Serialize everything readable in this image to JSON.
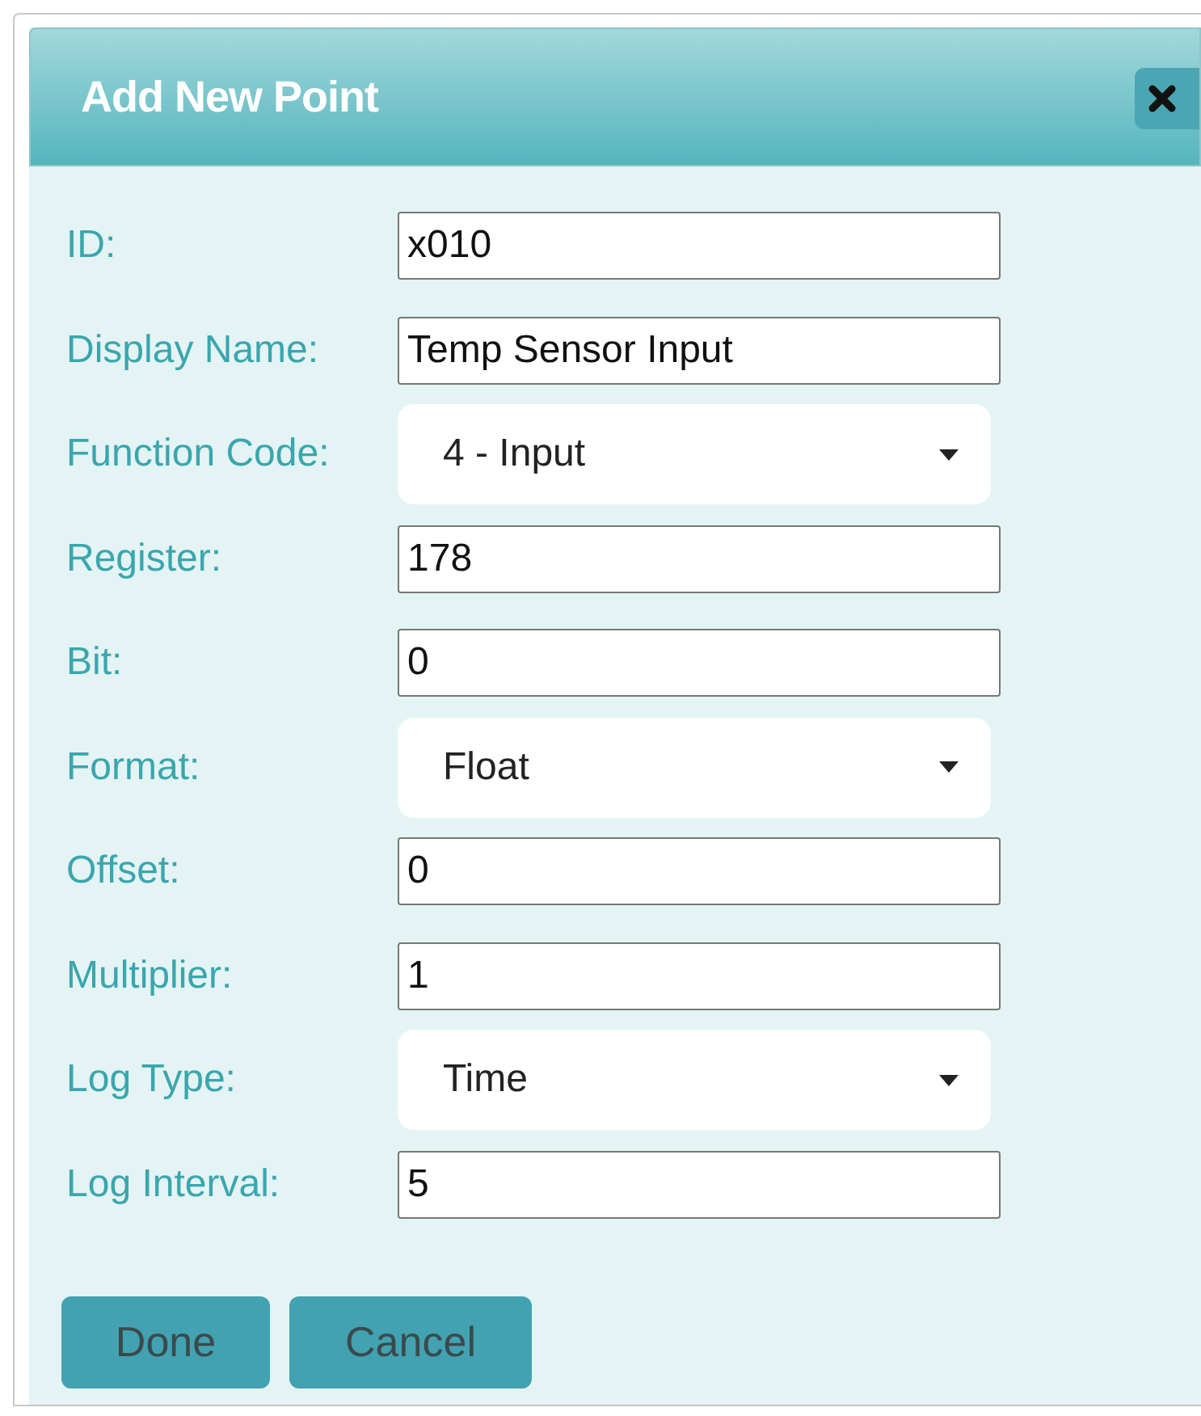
{
  "dialog": {
    "title": "Add New Point"
  },
  "fields": [
    {
      "label": "ID:",
      "kind": "text",
      "value": "x010"
    },
    {
      "label": "Display Name:",
      "kind": "text",
      "value": "Temp Sensor Input"
    },
    {
      "label": "Function Code:",
      "kind": "select",
      "value": "4 - Input"
    },
    {
      "label": "Register:",
      "kind": "text",
      "value": "178"
    },
    {
      "label": "Bit:",
      "kind": "text",
      "value": "0"
    },
    {
      "label": "Format:",
      "kind": "select",
      "value": "Float"
    },
    {
      "label": "Offset:",
      "kind": "text",
      "value": "0"
    },
    {
      "label": "Multiplier:",
      "kind": "text",
      "value": "1"
    },
    {
      "label": "Log Type:",
      "kind": "select",
      "value": "Time"
    },
    {
      "label": "Log Interval:",
      "kind": "text",
      "value": "5"
    }
  ],
  "buttons": [
    "Done",
    "Cancel"
  ]
}
